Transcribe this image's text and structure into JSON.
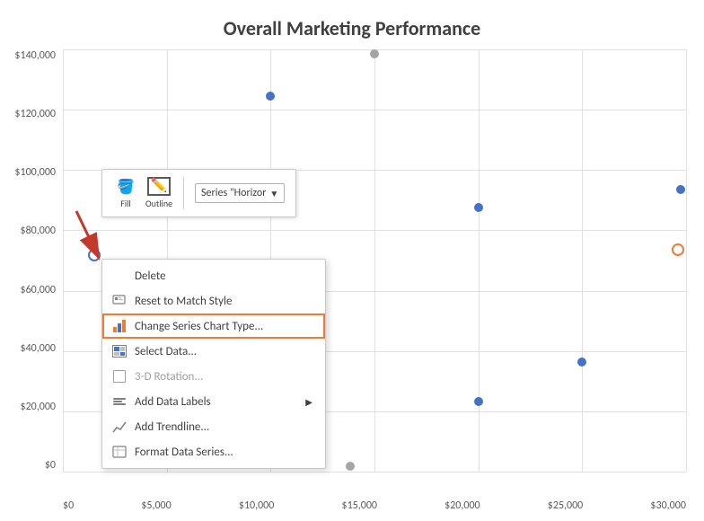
{
  "chart": {
    "title": "Overall Marketing Performance",
    "yAxis": {
      "labels": [
        "$140,000",
        "$120,000",
        "$100,000",
        "$80,000",
        "$60,000",
        "$40,000",
        "$20,000",
        "$0"
      ]
    },
    "xAxis": {
      "labels": [
        "$0",
        "$5,000",
        "$10,000",
        "$15,000",
        "$20,000",
        "$25,000",
        "$30,000"
      ]
    }
  },
  "toolbar": {
    "fill_label": "Fill",
    "outline_label": "Outline",
    "series_label": "Series \"Horizor"
  },
  "contextMenu": {
    "items": [
      {
        "id": "delete",
        "label": "Delete",
        "icon": "delete",
        "hasIcon": false
      },
      {
        "id": "reset",
        "label": "Reset to Match Style",
        "icon": "reset",
        "hasIcon": true
      },
      {
        "id": "change-chart-type",
        "label": "Change Series Chart Type...",
        "icon": "chart",
        "highlighted": true
      },
      {
        "id": "select-data",
        "label": "Select Data...",
        "icon": "select-data",
        "hasIcon": true
      },
      {
        "id": "3d-rotation",
        "label": "3-D Rotation...",
        "icon": "3d",
        "disabled": true
      },
      {
        "id": "add-data-labels",
        "label": "Add Data Labels",
        "icon": "labels",
        "hasArrow": true
      },
      {
        "id": "add-trendline",
        "label": "Add Trendline...",
        "icon": "trendline",
        "hasIcon": false
      },
      {
        "id": "format-data-series",
        "label": "Format Data Series...",
        "icon": "format",
        "hasIcon": true
      }
    ]
  }
}
